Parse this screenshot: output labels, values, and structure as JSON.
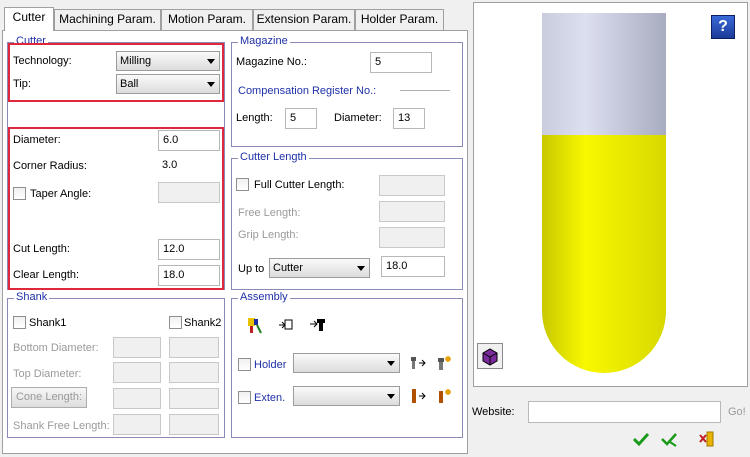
{
  "tabs": [
    "Cutter",
    "Machining Param.",
    "Motion Param.",
    "Extension Param.",
    "Holder Param."
  ],
  "cutter": {
    "title": "Cutter",
    "technology_label": "Technology:",
    "technology_value": "Milling",
    "tip_label": "Tip:",
    "tip_value": "Ball",
    "diameter_label": "Diameter:",
    "diameter_value": "6.0",
    "corner_radius_label": "Corner Radius:",
    "corner_radius_value": "3.0",
    "taper_angle_label": "Taper Angle:",
    "taper_angle_value": "",
    "cut_length_label": "Cut Length:",
    "cut_length_value": "12.0",
    "clear_length_label": "Clear Length:",
    "clear_length_value": "18.0"
  },
  "magazine": {
    "title": "Magazine",
    "magazine_no_label": "Magazine No.:",
    "magazine_no_value": "5",
    "comp_register_label": "Compensation Register No.:",
    "length_label": "Length:",
    "length_value": "5",
    "diameter_label": "Diameter:",
    "diameter_value": "13"
  },
  "cutter_length": {
    "title": "Cutter Length",
    "full_label": "Full Cutter Length:",
    "free_label": "Free Length:",
    "grip_label": "Grip Length:",
    "up_to_label": "Up to",
    "up_to_select": "Cutter",
    "up_to_value": "18.0"
  },
  "shank": {
    "title": "Shank",
    "shank1_label": "Shank1",
    "shank2_label": "Shank2",
    "bottom_diameter_label": "Bottom Diameter:",
    "top_diameter_label": "Top Diameter:",
    "cone_length_button": "Cone Length:",
    "shank_free_length_label": "Shank Free Length:"
  },
  "assembly": {
    "title": "Assembly",
    "holder_label": "Holder",
    "holder_value": "",
    "exten_label": "Exten.",
    "exten_value": ""
  },
  "preview": {
    "website_label": "Website:",
    "website_value": "",
    "go_label": "Go!"
  },
  "colors": {
    "group_title": "#1e30a8",
    "highlight_border": "#e0283c",
    "cutter_yellow": "#f0f000",
    "holder_gray": "#b8bcd0"
  }
}
